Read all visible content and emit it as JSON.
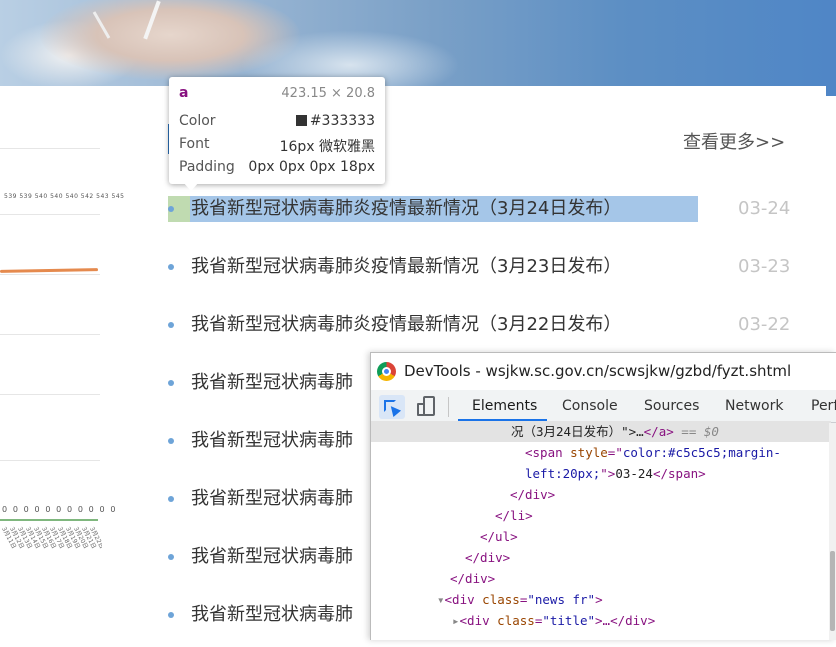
{
  "page": {
    "view_more": "查看更多>>",
    "news": [
      {
        "title": "我省新型冠状病毒肺炎疫情最新情况（3月24日发布）",
        "date": "03-24"
      },
      {
        "title": "我省新型冠状病毒肺炎疫情最新情况（3月23日发布）",
        "date": "03-23"
      },
      {
        "title": "我省新型冠状病毒肺炎疫情最新情况（3月22日发布）",
        "date": "03-22"
      },
      {
        "title": "我省新型冠状病毒肺",
        "date": ""
      },
      {
        "title": "我省新型冠状病毒肺",
        "date": ""
      },
      {
        "title": "我省新型冠状病毒肺",
        "date": ""
      },
      {
        "title": "我省新型冠状病毒肺",
        "date": ""
      },
      {
        "title": "我省新型冠状病毒肺",
        "date": ""
      }
    ]
  },
  "chart_fragment": {
    "top_ticks": "539 539 540 540 540 542 543 545",
    "zero_row": "0 0 0 0 0 0 0 0 0 0 0",
    "date_ticks": [
      "3月11日",
      "3月12日",
      "3月13日",
      "3月14日",
      "3月15日",
      "3月16日",
      "3月17日",
      "3月18日",
      "3月19日",
      "3月20日",
      "3月21日",
      "3月22日"
    ]
  },
  "inspector": {
    "tag": "a",
    "size": "423.15 × 20.8",
    "color_label": "Color",
    "color_value": "#333333",
    "font_label": "Font",
    "font_value": "16px 微软雅黑",
    "padding_label": "Padding",
    "padding_value": "0px 0px 0px 18px"
  },
  "devtools": {
    "title": "DevTools - wsjkw.sc.gov.cn/scwsjkw/gzbd/fyzt.shtml",
    "tabs": [
      "Elements",
      "Console",
      "Sources",
      "Network",
      "Perf"
    ],
    "active_tab": "Elements",
    "code": {
      "l0_text": "况（3月24日发布）\">…",
      "l0_close": "</a>",
      "l0_eq": " == $0",
      "l1_open": "<span ",
      "l1_attr": "style",
      "l1_eq": "=\"",
      "l1_val": "color:#c5c5c5;margin-",
      "l2_val": "left:20px;",
      "l2_q": "\">",
      "l2_text": "03-24",
      "l2_close": "</span>",
      "l3": "</div>",
      "l4": "</li>",
      "l5": "</ul>",
      "l6": "</div>",
      "l7": "</div>",
      "l8_open": "<div ",
      "l8_attr": "class",
      "l8_val": "\"news fr\"",
      "l8_end": ">",
      "l9_open": "<div ",
      "l9_attr": "class",
      "l9_val": "\"title\"",
      "l9_end": ">…</div>"
    }
  },
  "colors": {
    "accent_blue": "#1a73e8",
    "bullet": "#6ea4d8",
    "date_gray": "#c5c5c5",
    "text": "#333333"
  }
}
